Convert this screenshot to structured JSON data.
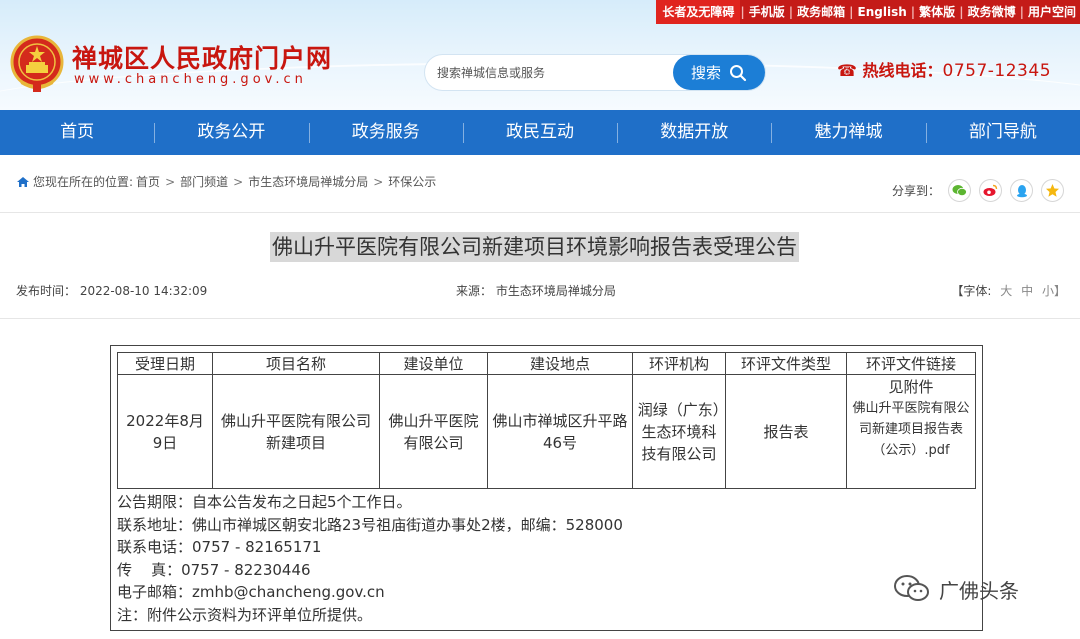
{
  "topbar": {
    "items": [
      "长者及无障碍",
      "手机版",
      "政务邮箱",
      "English",
      "繁体版",
      "政务微博",
      "用户空间"
    ]
  },
  "header": {
    "site_title": "禅城区人民政府门户网",
    "site_url": "www.chancheng.gov.cn",
    "search_placeholder": "搜索禅城信息或服务",
    "search_button": "搜索",
    "hotline_label": "热线电话：",
    "hotline_number": "0757-12345"
  },
  "nav": {
    "items": [
      "首页",
      "政务公开",
      "政务服务",
      "政民互动",
      "数据开放",
      "魅力禅城",
      "部门导航"
    ]
  },
  "breadcrumb": {
    "prefix": "您现在所在的位置:",
    "items": [
      "首页",
      "部门频道",
      "市生态环境局禅城分局",
      "环保公示"
    ]
  },
  "share": {
    "label": "分享到："
  },
  "article": {
    "title": "佛山升平医院有限公司新建项目环境影响报告表受理公告",
    "publish_time": "发布时间：  2022-08-10 14:32:09",
    "source": "来源：  市生态环境局禅城分局",
    "font_label": "【字体:",
    "font_large": "大",
    "font_medium": "中",
    "font_small": "小】"
  },
  "table": {
    "headers": [
      "受理日期",
      "项目名称",
      "建设单位",
      "建设地点",
      "环评机构",
      "环评文件类型",
      "环评文件链接"
    ],
    "row": {
      "date": "2022年8月9日",
      "project": "佛山升平医院有限公司新建项目",
      "unit": "佛山升平医院有限公司",
      "location": "佛山市禅城区升平路46号",
      "agency": "润绿（广东）生态环境科技有限公司",
      "doc_type": "报告表",
      "link_label": "见附件",
      "link_text": "佛山升平医院有限公司新建项目报告表（公示）.pdf"
    }
  },
  "notes": [
    "公告期限：自本公告发布之日起5个工作日。",
    "联系地址：佛山市禅城区朝安北路23号祖庙街道办事处2楼，邮编：528000",
    "联系电话：0757 - 82165171",
    "传    真：0757 - 82230446",
    "电子邮箱：zmhb@chancheng.gov.cn",
    "注：附件公示资料为环评单位所提供。"
  ],
  "watermark": {
    "text": "广佛头条"
  },
  "colors": {
    "brand_red": "#c8160f",
    "nav_blue": "#1f6fc8",
    "search_blue": "#1c7ed6"
  }
}
